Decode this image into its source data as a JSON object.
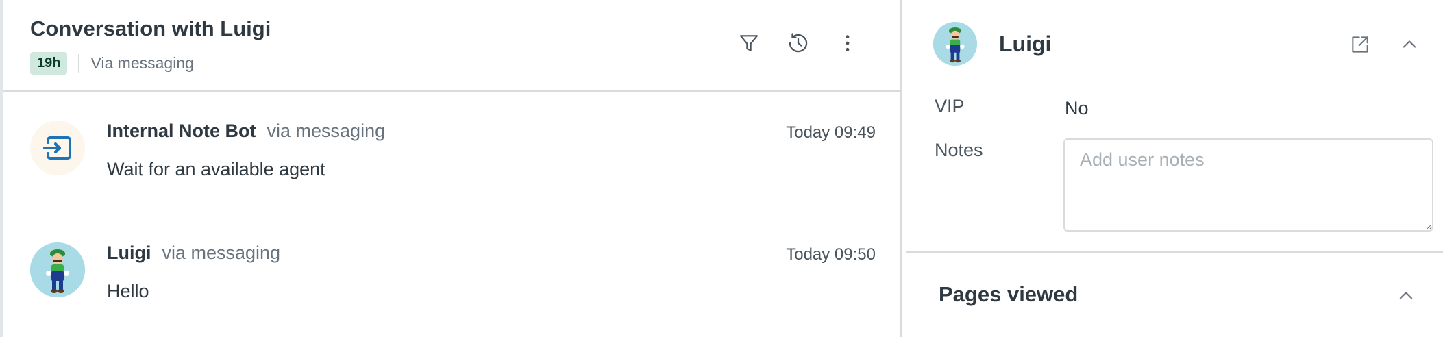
{
  "conversation": {
    "title": "Conversation with Luigi",
    "sla_badge": "19h",
    "channel": "Via messaging",
    "actions": {
      "filter_icon": "filter-icon",
      "history_icon": "history-icon",
      "more_icon": "more-vertical-icon"
    },
    "messages": [
      {
        "sender": "Internal Note Bot",
        "via": "via messaging",
        "time": "Today 09:49",
        "body": "Wait for an available agent",
        "avatar_icon": "bot-transfer-icon"
      },
      {
        "sender": "Luigi",
        "via": "via messaging",
        "time": "Today 09:50",
        "body": "Hello",
        "avatar_icon": "luigi-avatar"
      }
    ]
  },
  "user_panel": {
    "name": "Luigi",
    "actions": {
      "open_icon": "external-link-icon",
      "collapse_icon": "chevron-up-icon"
    },
    "fields": {
      "vip_label": "VIP",
      "vip_value": "No",
      "notes_label": "Notes",
      "notes_placeholder": "Add user notes",
      "notes_value": ""
    },
    "sections": {
      "pages_viewed": "Pages viewed"
    }
  },
  "colors": {
    "sla_badge_bg": "#d1e8df",
    "sla_badge_text": "#0b3b29",
    "bot_icon_blue": "#1f73b7",
    "avatar_bg": "#a8dbe6"
  }
}
